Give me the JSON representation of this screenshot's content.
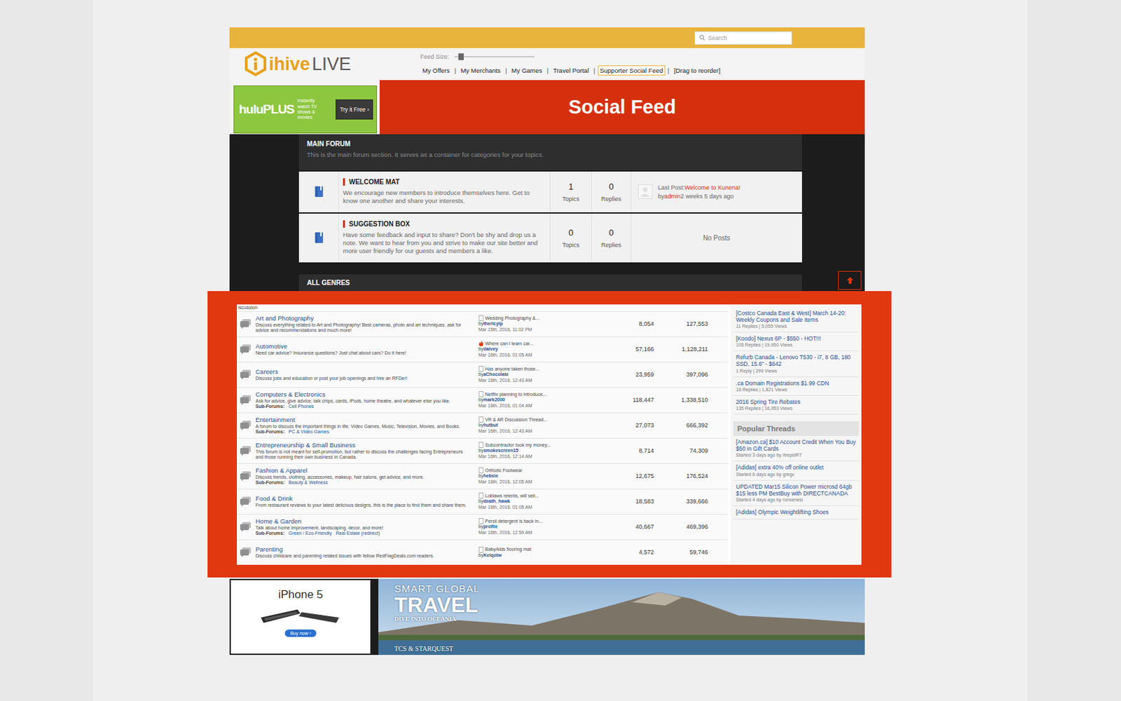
{
  "header": {
    "search_placeholder": "Search",
    "logo": {
      "part1": "ihive",
      "part2": "LIVE"
    },
    "feed_size": {
      "label": "Feed Size:",
      "level": 0.05
    },
    "separator": "|",
    "nav": [
      {
        "label": "My Offers",
        "selected": false
      },
      {
        "label": "My Merchants",
        "selected": false
      },
      {
        "label": "My Games",
        "selected": false
      },
      {
        "label": "Travel Portal",
        "selected": false
      },
      {
        "label": "Supporter Social Feed",
        "selected": true
      },
      {
        "label": "[Drag to reorder]",
        "selected": false
      }
    ]
  },
  "hulu_ad": {
    "brand": "huluPLUS",
    "tagline": "Instantly watch TV shows & movies",
    "button": "Try it Free ›"
  },
  "banner": {
    "title": "Social Feed"
  },
  "main_forum": {
    "title": "MAIN FORUM",
    "description": "This is the main forum section. It serves as a container for categories for your topics.",
    "categories": [
      {
        "title": "WELCOME MAT",
        "description": "We encourage new members to introduce themselves here. Get to know one another and share your interests.",
        "topics": "1",
        "topics_label": "Topics",
        "replies": "0",
        "replies_label": "Replies",
        "last_post": {
          "label": "Last Post:",
          "title": "Welcome to Kunena!",
          "by": "by",
          "author": "admin",
          "time": "2 weeks 5 days ago"
        },
        "no_posts": ""
      },
      {
        "title": "SUGGESTION BOX",
        "description": "Have some feedback and input to share? Don't be shy and drop us a note. We want to hear from you and strive to make our site better and more user friendly for our guests and members a like.",
        "topics": "0",
        "topics_label": "Topics",
        "replies": "0",
        "replies_label": "Replies",
        "last_post": null,
        "no_posts": "No Posts"
      }
    ]
  },
  "all_genres": {
    "title": "ALL GENRES"
  },
  "embedded_forum": {
    "header": "iscussion",
    "sub_forums_label": "Sub-Forums:",
    "by_label": "by",
    "rows": [
      {
        "title": "Art and Photography",
        "description": "Discuss everything related to Art and Photography! Best cameras, photo and art techniques, ask for advice and recommendations and much more!",
        "sub_forums": [],
        "last_topic": "Wedding Photography &...",
        "hot": false,
        "user": "thericyip",
        "date": "Mar 15th, 2016, 11:02 PM",
        "topics": "8,054",
        "posts": "127,553"
      },
      {
        "title": "Automotive",
        "description": "Need car advice? Insurance questions? Just chat about cars? Do it here!",
        "sub_forums": [],
        "last_topic": "Where can I learn car...",
        "hot": true,
        "user": "daivey",
        "date": "Mar 16th, 2016, 01:05 AM",
        "topics": "57,166",
        "posts": "1,128,211"
      },
      {
        "title": "Careers",
        "description": "Discuss jobs and education or post your job openings and hire an RFDer!",
        "sub_forums": [],
        "last_topic": "Has anyone taken those...",
        "hot": false,
        "user": "aChocolate",
        "date": "Mar 16th, 2016, 12:43 AM",
        "topics": "23,959",
        "posts": "397,096"
      },
      {
        "title": "Computers & Electronics",
        "description": "Ask for advice, give advice, talk chips, cards, iPods, home theatre, and whatever else you like.",
        "sub_forums": [
          "Cell Phones"
        ],
        "last_topic": "Netflix planning to introduce...",
        "hot": false,
        "user": "mark2000",
        "date": "Mar 16th, 2016, 01:04 AM",
        "topics": "118,447",
        "posts": "1,338,510"
      },
      {
        "title": "Entertainment",
        "description": "A forum to discuss the important things in life: Video Games, Music, Television, Movies, and Books.",
        "sub_forums": [
          "PC & Video Games"
        ],
        "last_topic": "VR & AR Discussion Thread...",
        "hot": false,
        "user": "hutbut",
        "date": "Mar 16th, 2016, 12:43 AM",
        "topics": "27,073",
        "posts": "666,392"
      },
      {
        "title": "Entrepreneurship & Small Business",
        "description": "This forum is not meant for self-promotion, but rather to discuss the challenges facing Entrepreneurs and those running their own business in Canada.",
        "sub_forums": [],
        "last_topic": "Subcontractor took my money...",
        "hot": false,
        "user": "smokescreen15",
        "date": "Mar 16th, 2016, 12:14 AM",
        "topics": "8,714",
        "posts": "74,309"
      },
      {
        "title": "Fashion & Apparel",
        "description": "Discuss trends, clothing, accessories, makeup, hair salons, get advice, and more.",
        "sub_forums": [
          "Beauty & Wellness"
        ],
        "last_topic": "Orthotic Footwear",
        "hot": false,
        "user": "hebsie",
        "date": "Mar 16th, 2016, 12:05 AM",
        "topics": "12,675",
        "posts": "176,524"
      },
      {
        "title": "Food & Drink",
        "description": "From restaurant reviews to your latest delicious designs, this is the place to find them and share them.",
        "sub_forums": [],
        "last_topic": "Loblaws relents, will sell...",
        "hot": false,
        "user": "death_hawk",
        "date": "Mar 16th, 2016, 01:05 AM",
        "topics": "18,583",
        "posts": "339,666"
      },
      {
        "title": "Home & Garden",
        "description": "Talk about home improvement, landscaping, decor, and more!",
        "sub_forums": [
          "Green / Eco-Friendly",
          "Real Estate (redirect)"
        ],
        "last_topic": "Persil detergent is back in...",
        "hot": false,
        "user": "profile",
        "date": "Mar 16th, 2016, 12:59 AM",
        "topics": "40,667",
        "posts": "469,396"
      },
      {
        "title": "Parenting",
        "description": "Discuss childcare and parenting related issues with fellow RedFlagDeals.com readers.",
        "sub_forums": [],
        "last_topic": "Baby/kids flooring mat",
        "hot": false,
        "user": "Keiqotw",
        "date": "",
        "topics": "4,572",
        "posts": "59,746"
      }
    ],
    "sidebar": {
      "deals": [
        {
          "title": "[Costco Canada East & West] March 14-20: Weekly Coupons and Sale Items",
          "meta": "11 Replies | 5,055 Views"
        },
        {
          "title": "[Koodo] Nexus 6P - $550 - HOT!!!",
          "meta": "105 Replies | 19,950 Views"
        },
        {
          "title": "Refurb Canada - Lenovo T530 - i7, 8 GB, 180 SSD, 15.6\" - $642",
          "meta": "1 Reply | 299 Views"
        },
        {
          "title": ".ca Domain Registrations $1.99 CDN",
          "meta": "16 Replies | 1,821 Views"
        },
        {
          "title": "2016 Spring Tire Rebates",
          "meta": "135 Replies | 16,953 Views"
        }
      ],
      "popular_title": "Popular Threads",
      "popular": [
        {
          "title": "[Amazon.ca] $10 Account Credit When You Buy $50 in Gift Cards",
          "meta": "Started 3 days ago by ItrepidRT"
        },
        {
          "title": "[Adidas] extra 40% off online outlet",
          "meta": "Started 6 days ago by gregv"
        },
        {
          "title": "UPDATED Mar15 Silicon Power microsd 64gb $15 less PM BestBuy with DIRECTCANADA",
          "meta": "Started 4 days ago by ronsenesi"
        },
        {
          "title": "[Adidas] Olympic Weightlifting Shoes",
          "meta": ""
        }
      ]
    }
  },
  "ads": {
    "iphone": {
      "title": "iPhone 5",
      "button": "Buy now ›"
    },
    "travel": {
      "line1": "SMART GLOBAL",
      "line2": "TRAVEL",
      "line3": "DIVE INTO OCEANIA",
      "brand": "TCS & STARQUEST"
    }
  }
}
